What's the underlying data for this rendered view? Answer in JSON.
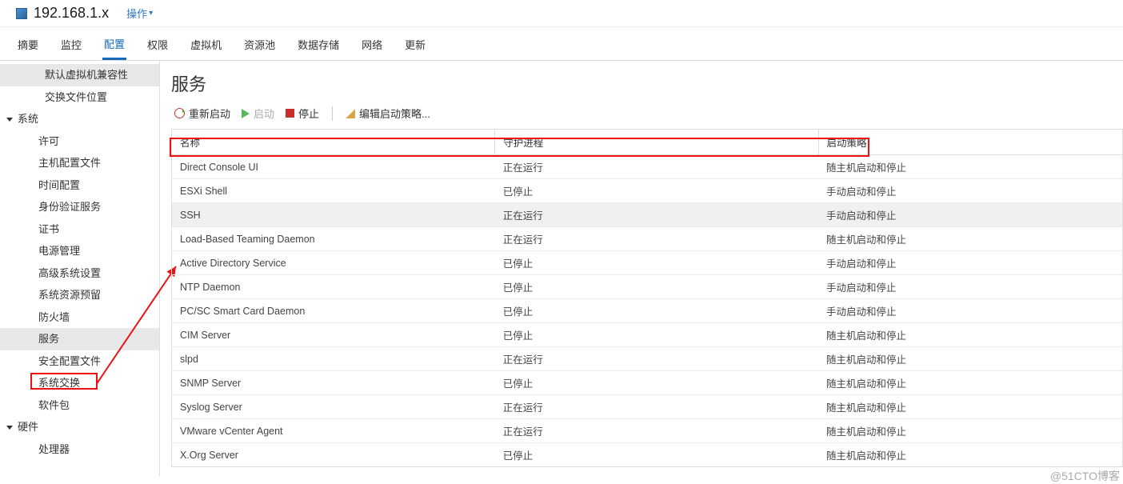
{
  "header": {
    "host_name": "192.168.1.x",
    "actions_label": "操作"
  },
  "tabs": [
    {
      "label": "摘要",
      "active": false
    },
    {
      "label": "监控",
      "active": false
    },
    {
      "label": "配置",
      "active": true
    },
    {
      "label": "权限",
      "active": false
    },
    {
      "label": "虚拟机",
      "active": false
    },
    {
      "label": "资源池",
      "active": false
    },
    {
      "label": "数据存储",
      "active": false
    },
    {
      "label": "网络",
      "active": false
    },
    {
      "label": "更新",
      "active": false
    }
  ],
  "sidebar": [
    {
      "label": "默认虚拟机兼容性",
      "depth": 2,
      "selected": true
    },
    {
      "label": "交换文件位置",
      "depth": 2
    },
    {
      "label": "系统",
      "depth": 0,
      "expandable": true
    },
    {
      "label": "许可",
      "depth": 1
    },
    {
      "label": "主机配置文件",
      "depth": 1
    },
    {
      "label": "时间配置",
      "depth": 1
    },
    {
      "label": "身份验证服务",
      "depth": 1
    },
    {
      "label": "证书",
      "depth": 1
    },
    {
      "label": "电源管理",
      "depth": 1
    },
    {
      "label": "高级系统设置",
      "depth": 1
    },
    {
      "label": "系统资源预留",
      "depth": 1
    },
    {
      "label": "防火墙",
      "depth": 1
    },
    {
      "label": "服务",
      "depth": 1,
      "selected": true
    },
    {
      "label": "安全配置文件",
      "depth": 1
    },
    {
      "label": "系统交换",
      "depth": 1
    },
    {
      "label": "软件包",
      "depth": 1
    },
    {
      "label": "硬件",
      "depth": 0,
      "expandable": true
    },
    {
      "label": "处理器",
      "depth": 1
    }
  ],
  "main": {
    "title": "服务",
    "toolbar": {
      "restart": "重新启动",
      "start": "启动",
      "stop": "停止",
      "edit": "编辑启动策略..."
    },
    "columns": [
      "名称",
      "守护进程",
      "启动策略"
    ],
    "rows": [
      {
        "name": "Direct Console UI",
        "daemon": "正在运行",
        "policy": "随主机启动和停止"
      },
      {
        "name": "ESXi Shell",
        "daemon": "已停止",
        "policy": "手动启动和停止"
      },
      {
        "name": "SSH",
        "daemon": "正在运行",
        "policy": "手动启动和停止",
        "selected": true
      },
      {
        "name": "Load-Based Teaming Daemon",
        "daemon": "正在运行",
        "policy": "随主机启动和停止"
      },
      {
        "name": "Active Directory Service",
        "daemon": "已停止",
        "policy": "手动启动和停止"
      },
      {
        "name": "NTP Daemon",
        "daemon": "已停止",
        "policy": "手动启动和停止"
      },
      {
        "name": "PC/SC Smart Card Daemon",
        "daemon": "已停止",
        "policy": "手动启动和停止"
      },
      {
        "name": "CIM Server",
        "daemon": "已停止",
        "policy": "随主机启动和停止"
      },
      {
        "name": "slpd",
        "daemon": "正在运行",
        "policy": "随主机启动和停止"
      },
      {
        "name": "SNMP Server",
        "daemon": "已停止",
        "policy": "随主机启动和停止"
      },
      {
        "name": "Syslog Server",
        "daemon": "正在运行",
        "policy": "随主机启动和停止"
      },
      {
        "name": "VMware vCenter Agent",
        "daemon": "正在运行",
        "policy": "随主机启动和停止"
      },
      {
        "name": "X.Org Server",
        "daemon": "已停止",
        "policy": "随主机启动和停止"
      }
    ]
  },
  "watermark": "@51CTO博客"
}
